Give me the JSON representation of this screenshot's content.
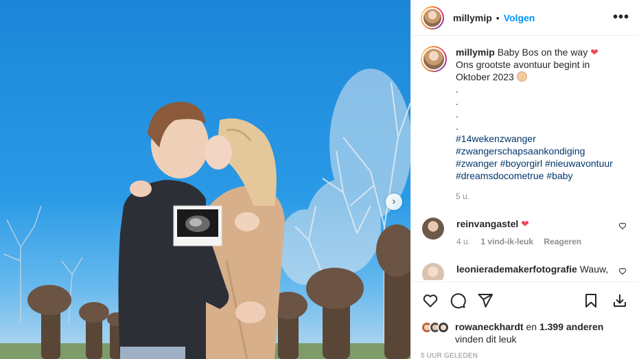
{
  "post": {
    "username": "millymip",
    "follow_label": "Volgen",
    "separator": "•",
    "more_label": "•••",
    "caption": {
      "username": "millymip",
      "line1": "Baby Bos on the way",
      "line2": "Ons grootste avontuur begint in Oktober 2023",
      "dots": [
        ".",
        ".",
        ".",
        "."
      ],
      "hashtags": [
        "#14wekenzwanger",
        "#zwangerschapsaankondiging",
        "#zwanger #boyorgirl #nieuwavontuur",
        "#dreamsdocometrue #baby"
      ],
      "age": "5 u."
    },
    "comments": [
      {
        "username": "reinvangastel",
        "text": "",
        "age": "4 u.",
        "likes": "1 vind-ik-leuk",
        "reply": "Reageren",
        "avatar_color": "#6b5a4a"
      },
      {
        "username": "leonierademakerfotografie",
        "text": "Wauw,",
        "age": "",
        "likes": "",
        "reply": "",
        "avatar_color": "#d9c3ae"
      }
    ],
    "liked_by": {
      "user": "rowaneckhardt",
      "connector": "en",
      "count": "1.399 anderen",
      "suffix": "vinden dit leuk"
    },
    "timestamp": "5 UUR GELEDEN",
    "next_label": "›"
  },
  "colors": {
    "accent": "#0095f6",
    "heart": "#ed4956",
    "meta": "#8e8e8e",
    "hashtag": "#00376b"
  }
}
